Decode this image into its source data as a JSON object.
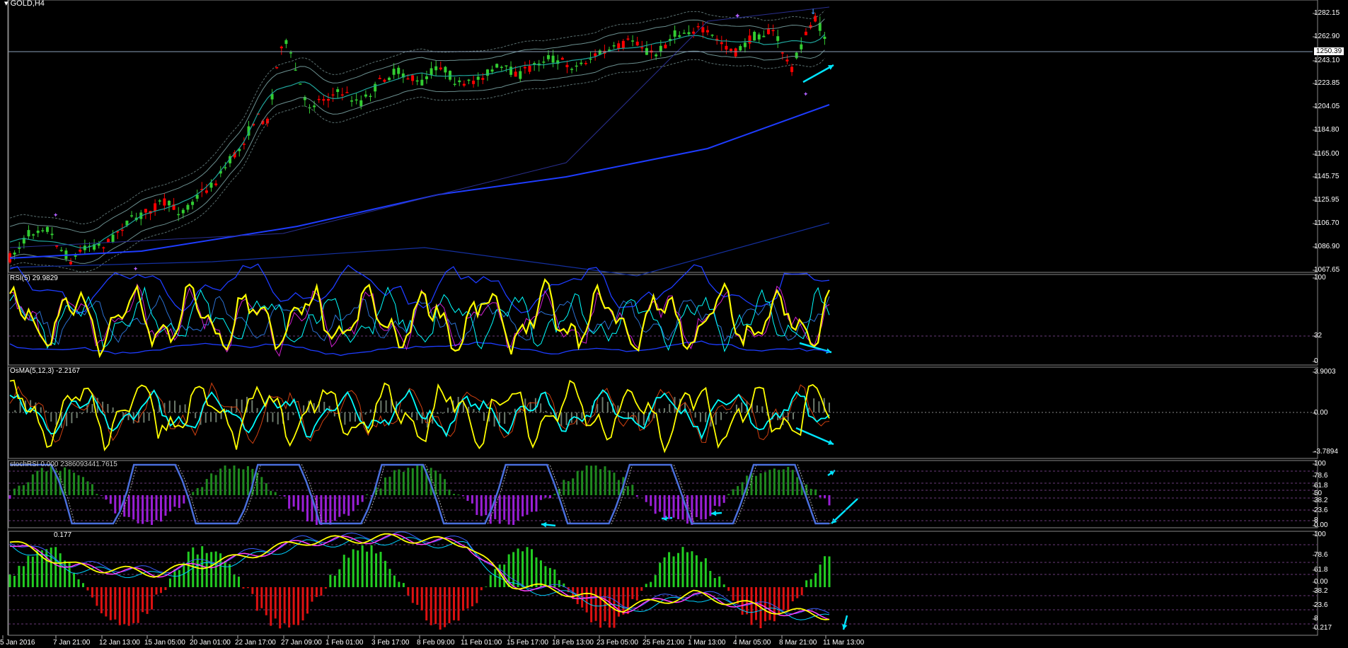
{
  "window": {
    "symbol_title": "GOLD,H4",
    "menu_icon": "triangle-down-icon"
  },
  "price_axis": {
    "ticks": [
      "1282.15",
      "1262.90",
      "1243.10",
      "1223.85",
      "1204.05",
      "1184.80",
      "1165.00",
      "1145.75",
      "1125.95",
      "1106.70",
      "1086.90",
      "1067.65"
    ],
    "current_price": "1250.39"
  },
  "panels": {
    "rsi": {
      "label": "RSI(5) 29.9829",
      "ticks": [
        "100",
        "32",
        "0"
      ]
    },
    "osma": {
      "label": "OsMA(5,12,3) -2.2167",
      "ticks": [
        "3.9003",
        "0.00",
        "-3.7894"
      ]
    },
    "stoch": {
      "label": "stochRSI 0.000 2386093441.7615",
      "ticks": [
        "100",
        "78.6",
        "61.8",
        "50",
        "38.2",
        "23.6",
        "8",
        "0.00"
      ]
    },
    "bottom": {
      "label": "0.177",
      "ticks": [
        "100",
        "78.6",
        "61.8",
        "0.00",
        "38.2",
        "23.6",
        "8",
        "0.217"
      ]
    }
  },
  "time_axis": [
    "5 Jan 2016",
    "7 Jan 21:00",
    "12 Jan 13:00",
    "15 Jan 05:00",
    "20 Jan 01:00",
    "22 Jan 17:00",
    "27 Jan 09:00",
    "1 Feb 01:00",
    "3 Feb 17:00",
    "8 Feb 09:00",
    "11 Feb 01:00",
    "15 Feb 17:00",
    "18 Feb 13:00",
    "23 Feb 05:00",
    "25 Feb 21:00",
    "1 Mar 13:00",
    "4 Mar 05:00",
    "8 Mar 21:00",
    "11 Mar 13:00"
  ],
  "colors": {
    "bull": "#32cd32",
    "bear": "#ff0000",
    "rsi_line": "#ffff00",
    "signal": "#00ffff",
    "ma_blue": "#1e3cff",
    "stoch_line": "#4a6fdc",
    "hist_green": "#1f8a1f",
    "hist_purple": "#9a1fd6",
    "arrow": "#00e5ff"
  }
}
